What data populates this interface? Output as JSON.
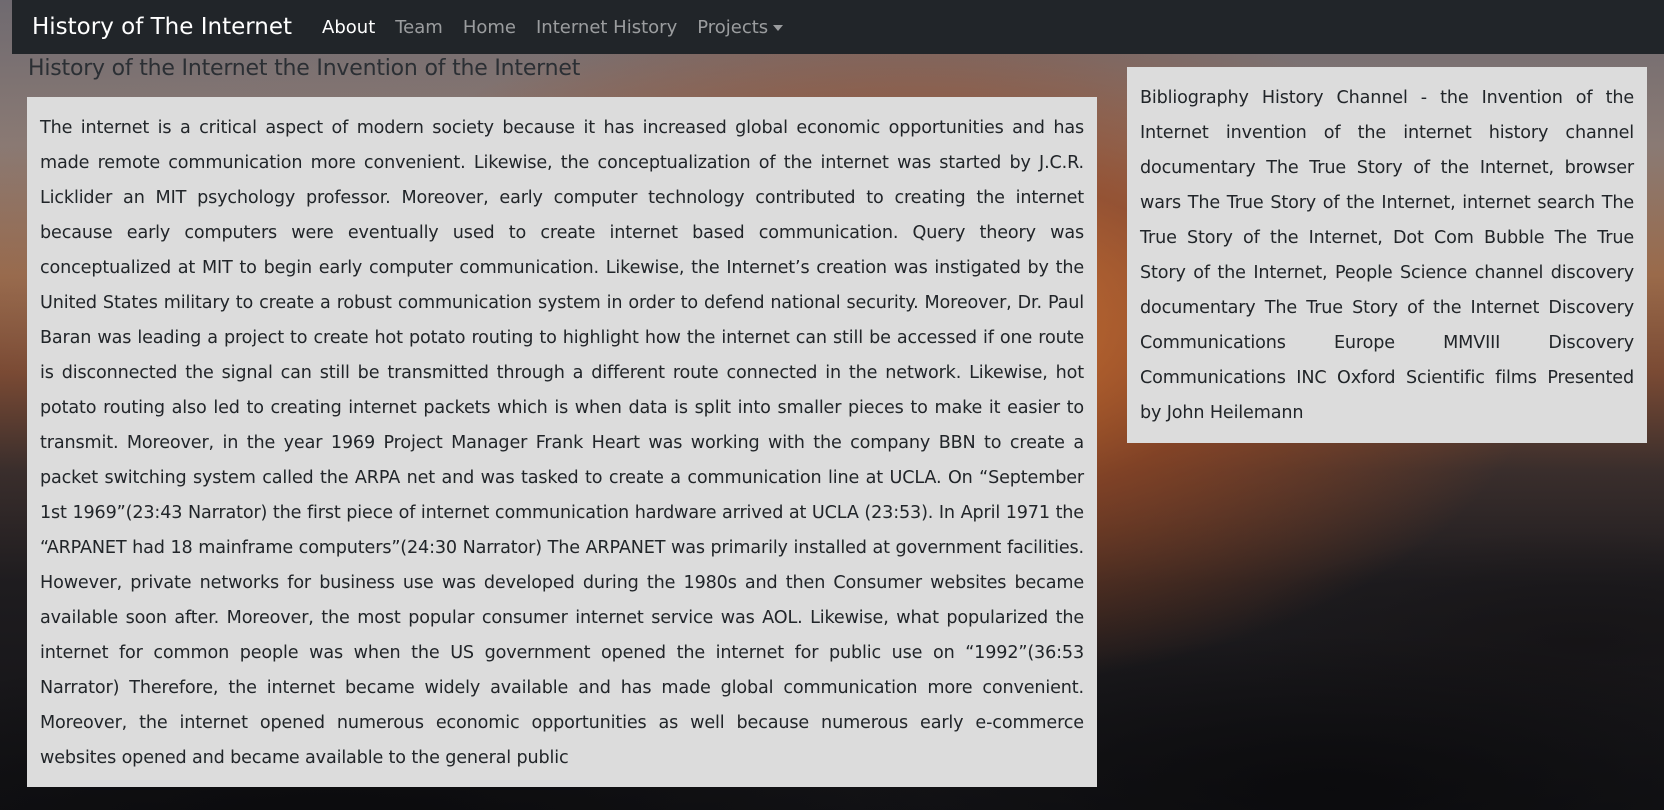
{
  "navbar": {
    "brand": "History of The Internet",
    "items": [
      {
        "label": "About",
        "active": true
      },
      {
        "label": "Team",
        "active": false
      },
      {
        "label": "Home",
        "active": false
      },
      {
        "label": "Internet History",
        "active": false
      },
      {
        "label": "Projects",
        "active": false,
        "dropdown": true
      }
    ]
  },
  "page": {
    "title": "History of the Internet the Invention of the Internet"
  },
  "main": {
    "body": "The internet is a critical aspect of modern society because it has increased global economic opportunities and has made remote communication more convenient. Likewise, the conceptualization of the internet was started by J.C.R. Licklider an MIT psychology professor. Moreover, early computer technology contributed to creating the internet because early computers were eventually used to create internet based communication. Query theory was conceptualized at MIT to begin early computer communication. Likewise, the Internet’s creation was instigated by the United States military to create a robust communication system in order to defend national security. Moreover, Dr. Paul Baran was leading a project to create hot potato routing to highlight how the internet can still be accessed if one route is disconnected the signal can still be transmitted through a different route connected in the network. Likewise, hot potato routing also led to creating internet packets which is when data is split into smaller pieces to make it easier to transmit. Moreover, in the year 1969 Project Manager Frank Heart was working with the company BBN to create a packet switching system called the ARPA net and was tasked to create a communication line at UCLA. On “September 1st 1969”(23:43 Narrator) the first piece of internet communication hardware arrived at UCLA (23:53). In April 1971 the “ARPANET had 18 mainframe computers”(24:30 Narrator) The ARPANET was primarily installed at government facilities. However, private networks for business use was developed during the 1980s and then Consumer websites became available soon after. Moreover, the most popular consumer internet service was AOL. Likewise, what popularized the internet for common people was when the US government opened the internet for public use on “1992”(36:53 Narrator) Therefore, the internet became widely available and has made global communication more convenient. Moreover, the internet opened numerous economic opportunities as well because numerous early e-commerce websites opened and became available to the general public"
  },
  "sidebar": {
    "bibliography": "Bibliography History Channel - the Invention of the Internet invention of the internet history channel documentary The True Story of the Internet, browser wars The True Story of the Internet, internet search The True Story of the Internet, Dot Com Bubble The True Story of the Internet, People Science channel discovery documentary The True Story of the Internet Discovery Communications Europe MMVIII Discovery Communications INC Oxford Scientific films Presented by John Heilemann"
  },
  "colors": {
    "navbar_bg": "#212529",
    "box_bg": "#dcdcdc",
    "text": "#212529"
  }
}
